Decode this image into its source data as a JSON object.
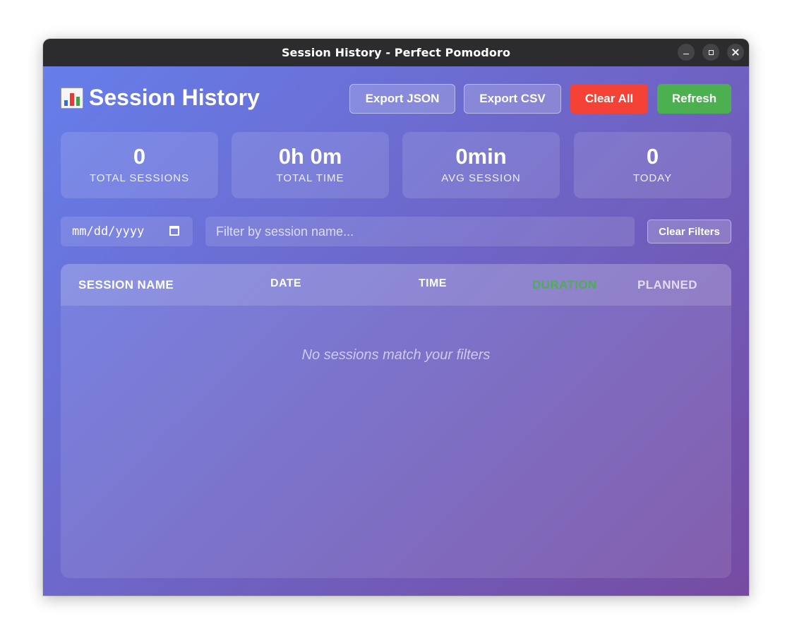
{
  "window": {
    "title": "Session History - Perfect Pomodoro"
  },
  "header": {
    "title": "Session History",
    "title_icon": "bar-chart-icon",
    "buttons": {
      "export_json": "Export JSON",
      "export_csv": "Export CSV",
      "clear_all": "Clear All",
      "refresh": "Refresh"
    }
  },
  "stats": [
    {
      "value": "0",
      "label": "TOTAL SESSIONS"
    },
    {
      "value": "0h 0m",
      "label": "TOTAL TIME"
    },
    {
      "value": "0min",
      "label": "AVG SESSION"
    },
    {
      "value": "0",
      "label": "TODAY"
    }
  ],
  "filters": {
    "date_placeholder": "mm/dd/yyyy",
    "search_placeholder": "Filter by session name...",
    "clear_label": "Clear Filters"
  },
  "table": {
    "columns": [
      "SESSION NAME",
      "DATE",
      "TIME",
      "DURATION",
      "PLANNED"
    ],
    "rows": [],
    "empty_message": "No sessions match your filters"
  },
  "colors": {
    "gradient_start": "#667eea",
    "gradient_end": "#764ba2",
    "danger": "#f44336",
    "success": "#4caf50",
    "duration_header": "#4caf50"
  }
}
